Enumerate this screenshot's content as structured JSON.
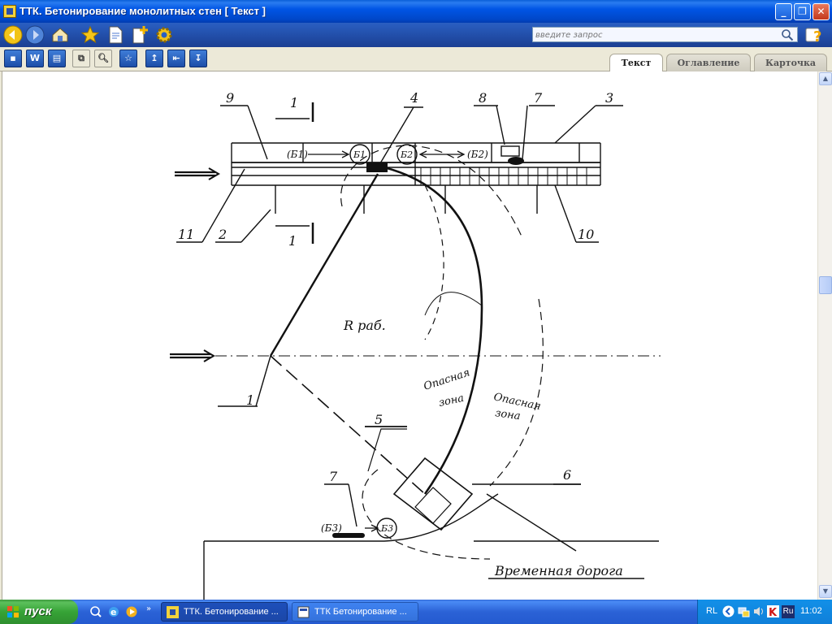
{
  "window": {
    "title": "ТТК. Бетонирование монолитных стен [ Текст ]",
    "controls": {
      "minimize": "_",
      "maximize": "❐",
      "close": "✕"
    }
  },
  "search": {
    "placeholder": "введите запрос"
  },
  "toolbar2": {
    "word_label": "W"
  },
  "tabs": [
    {
      "label": "Текст",
      "active": true
    },
    {
      "label": "Оглавление",
      "active": false
    },
    {
      "label": "Карточка",
      "active": false
    }
  ],
  "drawing": {
    "labels": {
      "n9": "9",
      "n1_top": "1",
      "n4": "4",
      "n8": "8",
      "n7_top": "7",
      "n3": "3",
      "n11": "11",
      "n2": "2",
      "n1_bot": "1",
      "n10": "10",
      "b1_left": "(Б1)",
      "b1": "Б1",
      "b2": "Б2",
      "b2_right": "(Б2)",
      "radius": "R раб.",
      "n1_left": "1",
      "danger1_a": "Опасная",
      "danger1_b": "зона",
      "danger2_a": "Опасная",
      "danger2_b": "зона",
      "n5": "5",
      "n6": "6",
      "n7_bot": "7",
      "b3_left": "(Б3)",
      "b3": "Б3",
      "road": "Временная дорога"
    }
  },
  "taskbar": {
    "start_label": "пуск",
    "tasks": [
      {
        "label": "ТТК. Бетонирование ..."
      },
      {
        "label": "ТТК Бетонирование ..."
      }
    ],
    "tray": {
      "lang": "RL",
      "keyboard": "Ru",
      "clock": "11:02"
    }
  }
}
